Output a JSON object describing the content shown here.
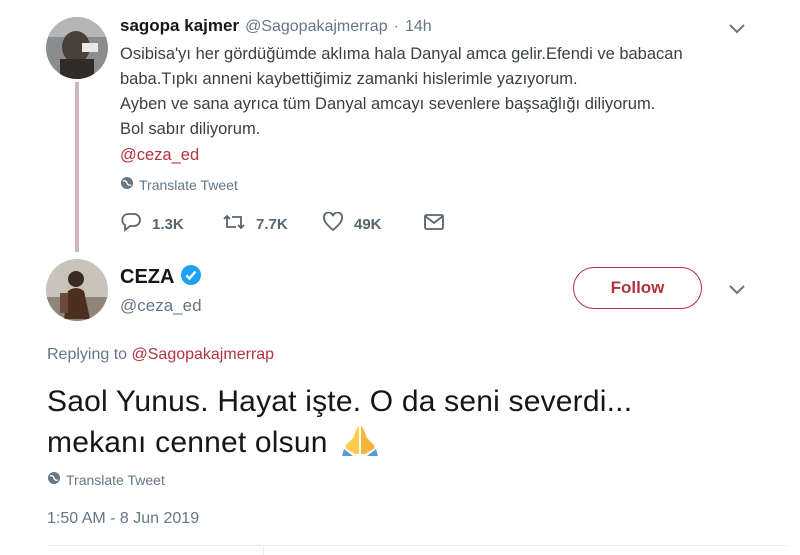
{
  "reply_tweet": {
    "author_name": "sagopa kajmer",
    "author_handle": "@Sagopakajmerrap",
    "separator": "·",
    "time": "14h",
    "lines": [
      "Osibisa'yı her gördüğümde aklıma hala Danyal amca gelir.Efendi ve babacan",
      "baba.Tıpkı anneni kaybettiğimiz zamanki hislerimle yazıyorum.",
      "Ayben ve sana ayrıca tüm Danyal amcayı sevenlere başsağlığı diliyorum.",
      "Bol sabır diliyorum."
    ],
    "mention": "@ceza_ed",
    "translate_label": "Translate Tweet",
    "actions": {
      "replies": "1.3K",
      "retweets": "7.7K",
      "likes": "49K"
    }
  },
  "main_tweet": {
    "author_name": "CEZA",
    "author_handle": "@ceza_ed",
    "follow_label": "Follow",
    "replying_prefix": "Replying to",
    "replying_to": "@Sagopakajmerrap",
    "text_line1": "Saol Yunus. Hayat işte. O da seni severdi...",
    "text_line2": "mekanı cennet olsun",
    "emoji": "🙏",
    "translate_label": "Translate Tweet",
    "timestamp": "1:50 AM - 8 Jun 2019"
  },
  "colors": {
    "accent": "#b0333d",
    "verified": "#1da1f2",
    "muted": "#657786",
    "thread_line": "#d4b5bd"
  }
}
